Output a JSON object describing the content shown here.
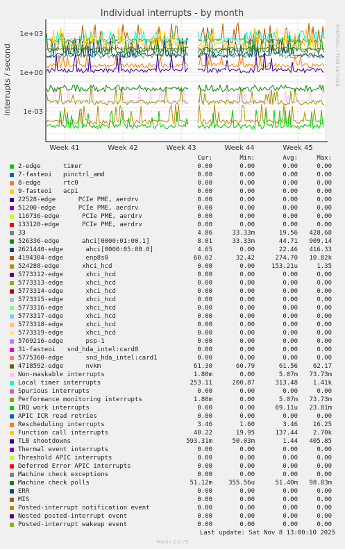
{
  "chart_data": {
    "type": "line",
    "title": "Individual interrupts - by month",
    "ylabel": "interrupts / second",
    "y_scale": "log",
    "y_ticks": [
      "1e+03",
      "1e+00",
      "1e-03"
    ],
    "x_ticks": [
      "Week 41",
      "Week 42",
      "Week 43",
      "Week 44",
      "Week 45"
    ],
    "grid": true,
    "legend_placement": "bottom",
    "watermark": "RRDTOOL / TOBI OETIKER",
    "columns": [
      "Cur:",
      "Min:",
      "Avg:",
      "Max:"
    ],
    "series": [
      {
        "name": "2-edge      timer",
        "color": "#00cc00",
        "cur": "0.00",
        "min": "0.00",
        "avg": "0.00",
        "max": "0.00"
      },
      {
        "name": "7-fasteoi   pinctrl_amd",
        "color": "#0066b3",
        "cur": "0.00",
        "min": "0.00",
        "avg": "0.00",
        "max": "0.00"
      },
      {
        "name": "8-edge      rtc0",
        "color": "#ff8000",
        "cur": "0.00",
        "min": "0.00",
        "avg": "0.00",
        "max": "0.00"
      },
      {
        "name": "9-fasteoi   acpi",
        "color": "#ffcc00",
        "cur": "0.00",
        "min": "0.00",
        "avg": "0.00",
        "max": "0.00"
      },
      {
        "name": "22528-edge      PCIe PME, aerdrv",
        "color": "#330099",
        "cur": "0.00",
        "min": "0.00",
        "avg": "0.00",
        "max": "0.00"
      },
      {
        "name": "51200-edge      PCIe PME, aerdrv",
        "color": "#990099",
        "cur": "0.00",
        "min": "0.00",
        "avg": "0.00",
        "max": "0.00"
      },
      {
        "name": "116736-edge      PCIe PME, aerdrv",
        "color": "#ccff00",
        "cur": "0.00",
        "min": "0.00",
        "avg": "0.00",
        "max": "0.00"
      },
      {
        "name": "133120-edge      PCIe PME, aerdrv",
        "color": "#ff0000",
        "cur": "0.00",
        "min": "0.00",
        "avg": "0.00",
        "max": "0.00"
      },
      {
        "name": "33",
        "color": "#808080",
        "cur": "4.86",
        "min": "33.33m",
        "avg": "19.56",
        "max": "428.68"
      },
      {
        "name": "526336-edge      ahci[0000:01:00.1]",
        "color": "#008f00",
        "cur": "8.01",
        "min": "33.33m",
        "avg": "44.71",
        "max": "909.14"
      },
      {
        "name": "2621440-edge      ahci[0000:05:00.0]",
        "color": "#00487d",
        "cur": "4.65",
        "min": "0.00",
        "avg": "22.46",
        "max": "416.33"
      },
      {
        "name": "4194304-edge      enp8s0",
        "color": "#b35a00",
        "cur": "60.62",
        "min": "32.42",
        "avg": "274.70",
        "max": "10.82k"
      },
      {
        "name": "524288-edge      xhci_hcd",
        "color": "#b38f00",
        "cur": "0.00",
        "min": "0.00",
        "avg": "153.21u",
        "max": "1.35"
      },
      {
        "name": "5773312-edge      xhci_hcd",
        "color": "#6b006b",
        "cur": "0.00",
        "min": "0.00",
        "avg": "0.00",
        "max": "0.00"
      },
      {
        "name": "5773313-edge      xhci_hcd",
        "color": "#8fb300",
        "cur": "0.00",
        "min": "0.00",
        "avg": "0.00",
        "max": "0.00"
      },
      {
        "name": "5773314-edge      xhci_hcd",
        "color": "#b30000",
        "cur": "0.00",
        "min": "0.00",
        "avg": "0.00",
        "max": "0.00"
      },
      {
        "name": "5773315-edge      xhci_hcd",
        "color": "#bebebe",
        "cur": "0.00",
        "min": "0.00",
        "avg": "0.00",
        "max": "0.00"
      },
      {
        "name": "5773316-edge      xhci_hcd",
        "color": "#80ff80",
        "cur": "0.00",
        "min": "0.00",
        "avg": "0.00",
        "max": "0.00"
      },
      {
        "name": "5773317-edge      xhci_hcd",
        "color": "#80c9ff",
        "cur": "0.00",
        "min": "0.00",
        "avg": "0.00",
        "max": "0.00"
      },
      {
        "name": "5773318-edge      xhci_hcd",
        "color": "#ffc080",
        "cur": "0.00",
        "min": "0.00",
        "avg": "0.00",
        "max": "0.00"
      },
      {
        "name": "5773319-edge      xhci_hcd",
        "color": "#ffe680",
        "cur": "0.00",
        "min": "0.00",
        "avg": "0.00",
        "max": "0.00"
      },
      {
        "name": "5769216-edge      psp-1",
        "color": "#aa80ff",
        "cur": "0.00",
        "min": "0.00",
        "avg": "0.00",
        "max": "0.00"
      },
      {
        "name": "31-fasteoi   snd_hda_intel:card0",
        "color": "#ee00cc",
        "cur": "0.00",
        "min": "0.00",
        "avg": "0.00",
        "max": "0.00"
      },
      {
        "name": "5775360-edge      snd_hda_intel:card1",
        "color": "#ff8080",
        "cur": "0.00",
        "min": "0.00",
        "avg": "0.00",
        "max": "0.00"
      },
      {
        "name": "4718592-edge      nvkm",
        "color": "#666600",
        "cur": "61.30",
        "min": "60.79",
        "avg": "61.56",
        "max": "62.17"
      },
      {
        "name": "Non-maskable interrupts",
        "color": "#ffbfff",
        "cur": "1.80m",
        "min": "0.00",
        "avg": "5.07m",
        "max": "73.73m"
      },
      {
        "name": "Local timer interrupts",
        "color": "#00ffcc",
        "cur": "253.11",
        "min": "200.87",
        "avg": "313.48",
        "max": "1.41k"
      },
      {
        "name": "Spurious interrupts",
        "color": "#cc6699",
        "cur": "0.00",
        "min": "0.00",
        "avg": "0.00",
        "max": "0.00"
      },
      {
        "name": "Performance monitoring interrupts",
        "color": "#999900",
        "cur": "1.80m",
        "min": "0.00",
        "avg": "5.07m",
        "max": "73.73m"
      },
      {
        "name": "IRQ work interrupts",
        "color": "#00cc00",
        "cur": "0.00",
        "min": "0.00",
        "avg": "69.11u",
        "max": "23.81m"
      },
      {
        "name": "APIC ICR read retries",
        "color": "#0066b3",
        "cur": "0.00",
        "min": "0.00",
        "avg": "0.00",
        "max": "0.00"
      },
      {
        "name": "Rescheduling interrupts",
        "color": "#ff8000",
        "cur": "3.46",
        "min": "1.60",
        "avg": "3.46",
        "max": "16.25"
      },
      {
        "name": "Function call interrupts",
        "color": "#ffcc00",
        "cur": "40.22",
        "min": "19.95",
        "avg": "137.44",
        "max": "2.70k"
      },
      {
        "name": "TLB shootdowns",
        "color": "#330099",
        "cur": "593.31m",
        "min": "50.03m",
        "avg": "1.44",
        "max": "405.85"
      },
      {
        "name": "Thermal event interrupts",
        "color": "#990099",
        "cur": "0.00",
        "min": "0.00",
        "avg": "0.00",
        "max": "0.00"
      },
      {
        "name": "Threshold APIC interrupts",
        "color": "#ccff00",
        "cur": "0.00",
        "min": "0.00",
        "avg": "0.00",
        "max": "0.00"
      },
      {
        "name": "Deferred Error APIC interrupts",
        "color": "#ff0000",
        "cur": "0.00",
        "min": "0.00",
        "avg": "0.00",
        "max": "0.00"
      },
      {
        "name": "Machine check exceptions",
        "color": "#808080",
        "cur": "0.00",
        "min": "0.00",
        "avg": "0.00",
        "max": "0.00"
      },
      {
        "name": "Machine check polls",
        "color": "#008f00",
        "cur": "51.12m",
        "min": "355.56u",
        "avg": "51.40m",
        "max": "98.83m"
      },
      {
        "name": "ERR",
        "color": "#00487d",
        "cur": "0.00",
        "min": "0.00",
        "avg": "0.00",
        "max": "0.00"
      },
      {
        "name": "MIS",
        "color": "#b35a00",
        "cur": "0.00",
        "min": "0.00",
        "avg": "0.00",
        "max": "0.00"
      },
      {
        "name": "Posted-interrupt notification event",
        "color": "#b38f00",
        "cur": "0.00",
        "min": "0.00",
        "avg": "0.00",
        "max": "0.00"
      },
      {
        "name": "Nested posted-interrupt event",
        "color": "#6b006b",
        "cur": "0.00",
        "min": "0.00",
        "avg": "0.00",
        "max": "0.00"
      },
      {
        "name": "Posted-interrupt wakeup event",
        "color": "#8fb300",
        "cur": "0.00",
        "min": "0.00",
        "avg": "0.00",
        "max": "0.00"
      }
    ]
  },
  "footer": {
    "last_update": "Last update: Sat Nov  8 13:00:10 2025",
    "munin_version": "Munin 2.0.73"
  }
}
